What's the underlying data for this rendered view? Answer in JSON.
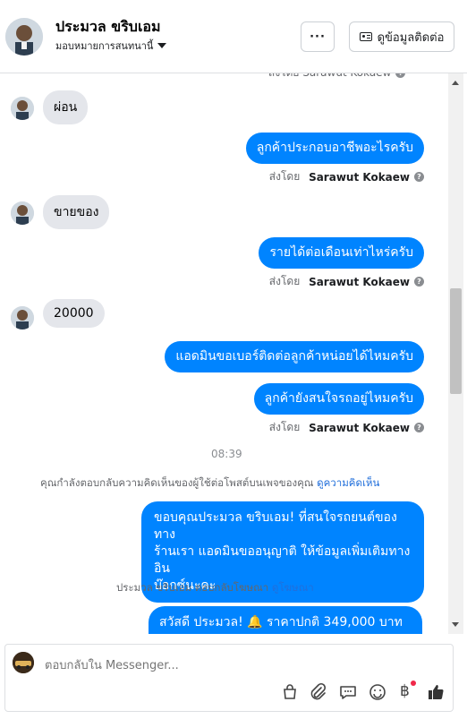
{
  "header": {
    "contact_name": "ประมวล ขริบเอม",
    "assignment": "มอบหมายการสนทนานี้",
    "more_label": "···",
    "view_contact_label": "ดูข้อมูลติดต่อ"
  },
  "chat": {
    "top_partial": "ส่งโดย Sarawut Kokaew",
    "messages": [
      {
        "dir": "in",
        "text": "ผ่อน"
      },
      {
        "dir": "out",
        "text": "ลูกค้าประกอบอาชีพอะไรครับ",
        "sent_by_prefix": "ส่งโดย",
        "sent_by": "Sarawut Kokaew"
      },
      {
        "dir": "in",
        "text": "ขายของ"
      },
      {
        "dir": "out",
        "text": "รายได้ต่อเดือนเท่าไหร่ครับ",
        "sent_by_prefix": "ส่งโดย",
        "sent_by": "Sarawut Kokaew"
      },
      {
        "dir": "in",
        "text": "20000"
      },
      {
        "dir": "out",
        "text": "แอดมินขอเบอร์ติดต่อลูกค้าหน่อยได้ไหมครับ"
      },
      {
        "dir": "out",
        "text": "ลูกค้ายังสนใจรถอยู่ไหมครับ",
        "sent_by_prefix": "ส่งโดย",
        "sent_by": "Sarawut Kokaew"
      }
    ],
    "timestamp": "08:39",
    "system_comment": {
      "text": "คุณกำลังตอบกลับความคิดเห็นของผู้ใช้ต่อโพสต์บนเพจของคุณ",
      "link": "ดูความคิดเห็น"
    },
    "long_reply": [
      "ขอบคุณประมวล ขริบเอม! ที่สนใจรถยนต์ของทาง",
      "ร้านเรา แอดมินขออนุญาติ ให้ข้อมูลเพิ่มเติมทางอิน",
      "บ๊อกซ์นะคะ"
    ],
    "system_ad": {
      "text": "ประมวล ขริบเอม ตอบกลับโฆษณา",
      "link": "ดูโฆษณา"
    },
    "last_partial": "สวัสดี ประมวล! 🔔  ราคาปกติ 349,000 บาท"
  },
  "composer": {
    "placeholder": "ตอบกลับใน Messenger..."
  },
  "icons": [
    "more-icon",
    "contact-card-icon",
    "chevron-down-icon",
    "help-icon",
    "shop-icon",
    "attach-icon",
    "saved-reply-icon",
    "emoji-icon",
    "baht-icon",
    "like-icon"
  ],
  "colors": {
    "accent": "#0084ff",
    "incoming": "#e4e6eb",
    "notification_dot": "#f02849"
  }
}
